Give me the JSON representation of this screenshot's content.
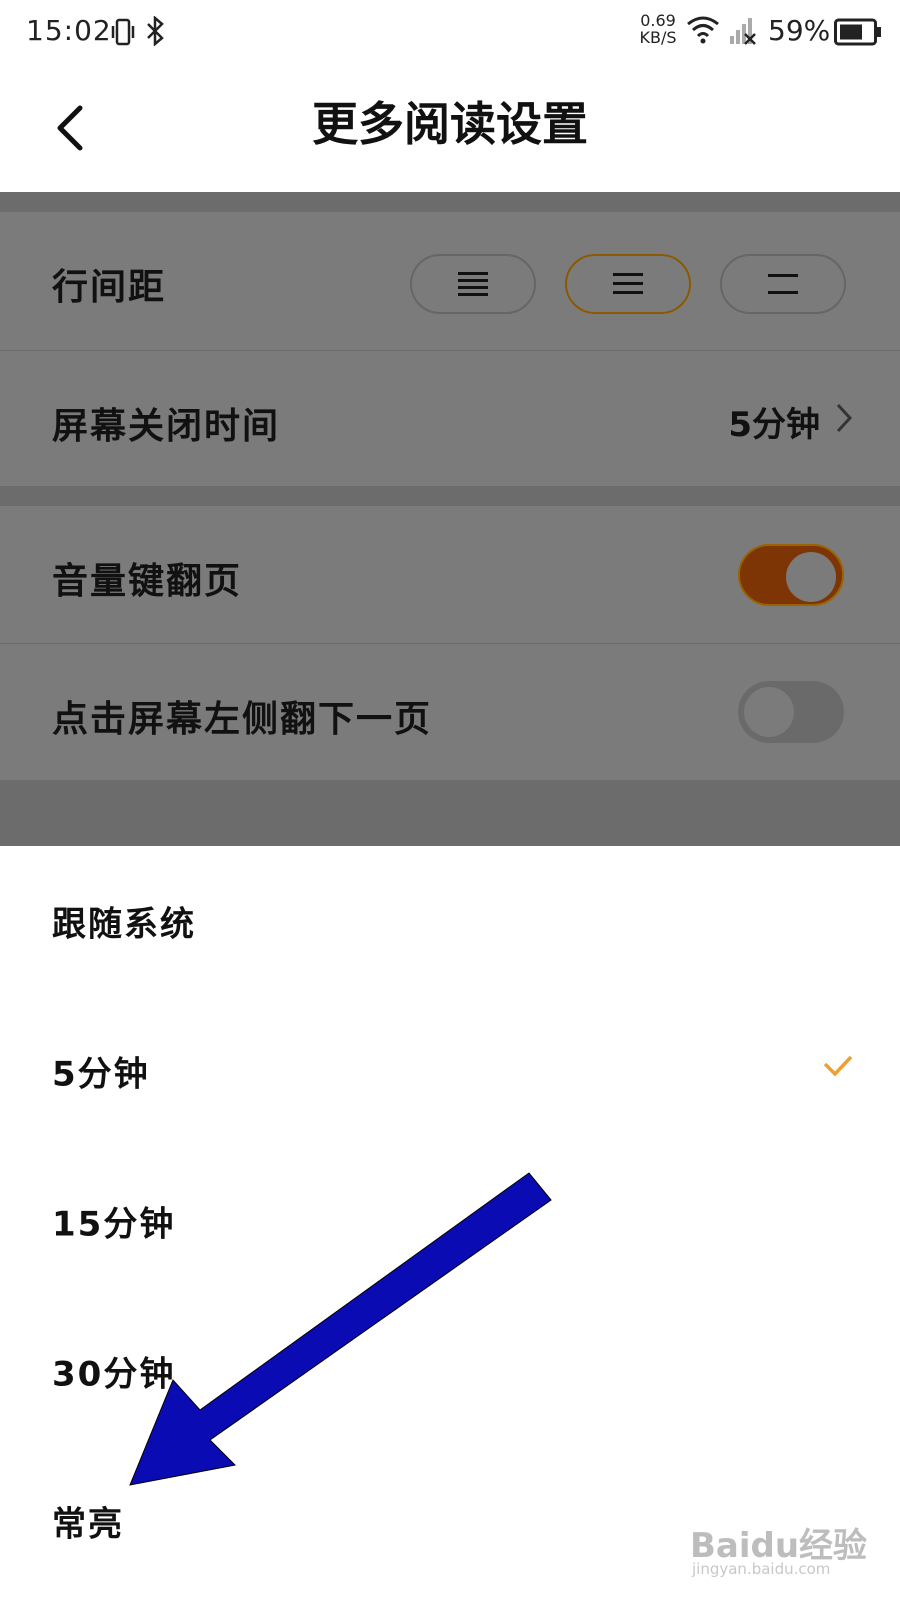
{
  "status_bar": {
    "time": "15:02",
    "net_speed_value": "0.69",
    "net_speed_unit": "KB/S",
    "battery_percent": "59%",
    "icons": [
      "vibrate-icon",
      "bluetooth-icon",
      "wifi-icon",
      "signal-no-service-icon",
      "battery-icon"
    ]
  },
  "header": {
    "title": "更多阅读设置",
    "back_icon": "chevron-left-icon"
  },
  "settings": {
    "line_spacing": {
      "label": "行间距",
      "options": [
        "spacing-compact-icon",
        "spacing-medium-icon",
        "spacing-loose-icon"
      ],
      "selected_index": 1
    },
    "screen_off_time": {
      "label": "屏幕关闭时间",
      "value": "5分钟"
    },
    "volume_key_page_turn": {
      "label": "音量键翻页",
      "on": true
    },
    "tap_left_next_page": {
      "label": "点击屏幕左侧翻下一页",
      "on": false
    }
  },
  "sheet": {
    "options": [
      "跟随系统",
      "5分钟",
      "15分钟",
      "30分钟",
      "常亮"
    ],
    "selected": "5分钟"
  },
  "colors": {
    "accent": "#f0a030",
    "toggle_on": "#7e3506",
    "overlay_gray": "#7b7b7b",
    "arrow_blue": "#0b0bb3"
  },
  "watermark": {
    "logo_text": "Baidu经验",
    "url": "jingyan.baidu.com"
  }
}
